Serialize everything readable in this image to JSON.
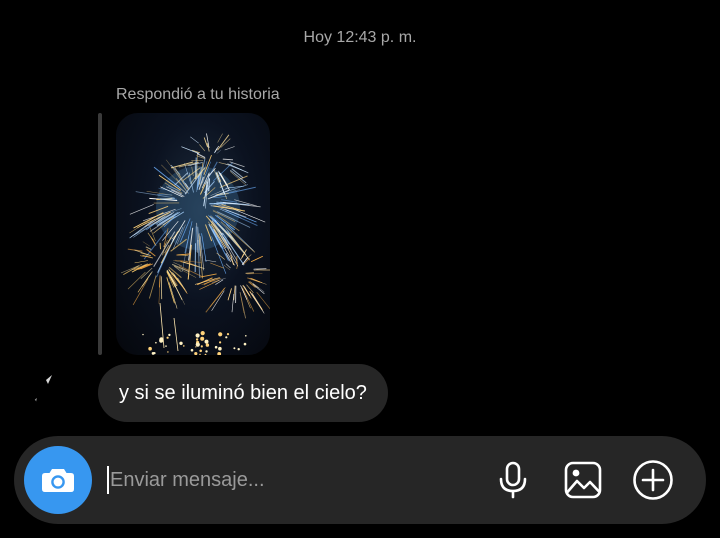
{
  "thread": {
    "timestamp": "Hoy 12:43 p. m.",
    "story_reply_label": "Respondió a tu historia",
    "messages": [
      {
        "sender": "other",
        "text": "y si se iluminó bien el cielo?"
      }
    ]
  },
  "composer": {
    "placeholder": "Enviar mensaje...",
    "value": "",
    "icons": [
      "camera-icon",
      "microphone-icon",
      "gallery-icon",
      "plus-circle-icon"
    ]
  },
  "colors": {
    "background": "#000000",
    "bubble": "#262626",
    "composer": "#262626",
    "accent": "#3797f0",
    "muted_text": "#a8a8a8"
  }
}
